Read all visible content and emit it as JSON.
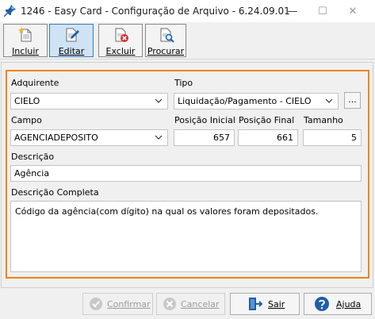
{
  "window": {
    "title": "1246 - Easy Card - Configuração de Arquivo - 6.24.09.01",
    "minimize_symbol": "—",
    "maximize_symbol": "☐",
    "close_symbol": "✕"
  },
  "toolbar": {
    "buttons": [
      {
        "label": "Incluir",
        "icon": "new-document-icon"
      },
      {
        "label": "Editar",
        "icon": "edit-document-icon",
        "active": true
      },
      {
        "label": "Excluir",
        "icon": "delete-document-icon"
      },
      {
        "label": "Procurar",
        "icon": "search-document-icon"
      }
    ]
  },
  "form": {
    "adquirente": {
      "label": "Adquirente",
      "value": "CIELO"
    },
    "tipo": {
      "label": "Tipo",
      "value": "Liquidação/Pagamento - CIELO",
      "ellipsis": "..."
    },
    "campo": {
      "label": "Campo",
      "value": "AGENCIADEPOSITO"
    },
    "posicao_inicial": {
      "label": "Posição Inicial",
      "value": "657"
    },
    "posicao_final": {
      "label": "Posição Final",
      "value": "661"
    },
    "tamanho": {
      "label": "Tamanho",
      "value": "5"
    },
    "descricao": {
      "label": "Descrição",
      "value": "Agência"
    },
    "descricao_completa": {
      "label": "Descrição Completa",
      "value": "Código da agência(com dígito) na qual os valores foram depositados."
    }
  },
  "footer": {
    "confirmar": {
      "label": "Confirmar",
      "icon": "check-circle-icon",
      "enabled": false
    },
    "cancelar": {
      "label": "Cancelar",
      "icon": "cancel-circle-icon",
      "enabled": false
    },
    "sair": {
      "label": "Sair",
      "icon": "exit-door-icon",
      "enabled": true
    },
    "ajuda": {
      "label": "Ajuda",
      "icon": "help-icon",
      "enabled": true
    }
  },
  "colors": {
    "accent_frame": "#ee8413",
    "active_button": "#cfe3f5",
    "icon_blue": "#1f5fa8"
  }
}
